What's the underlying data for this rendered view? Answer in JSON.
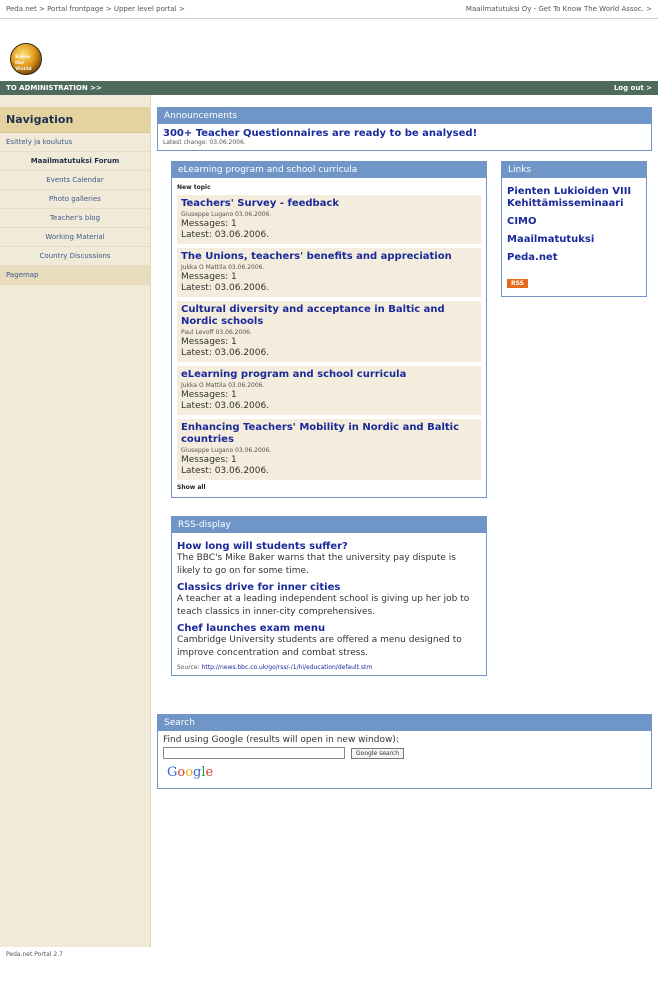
{
  "breadcrumbs": [
    "Peda.net >",
    "Portal frontpage >",
    "Upper level portal >"
  ],
  "org_title": "Maailmatutuksi Oy - Get To Know The World Assoc. >",
  "logo_text": "Know the World",
  "admin_link": "TO ADMINISTRATION >>",
  "logout": "Log out >",
  "navigation": {
    "title": "Navigation",
    "items": [
      {
        "label": "Esittely ja koulutus",
        "sub": false,
        "active": false
      },
      {
        "label": "Maailmatutuksi Forum",
        "sub": true,
        "active": true
      },
      {
        "label": "Events Calendar",
        "sub": true,
        "active": false
      },
      {
        "label": "Photo galleries",
        "sub": true,
        "active": false
      },
      {
        "label": "Teacher's blog",
        "sub": true,
        "active": false
      },
      {
        "label": "Working Material",
        "sub": true,
        "active": false
      },
      {
        "label": "Country Discussions",
        "sub": true,
        "active": false
      }
    ],
    "pagemap": "Pagemap"
  },
  "announcements": {
    "title": "Announcements",
    "headline": "300+ Teacher Questionnaires are ready to be analysed!",
    "latest": "Latest change: 03.06.2006."
  },
  "forum": {
    "title": "eLearning program and school curricula",
    "new_topic": "New topic",
    "posts": [
      {
        "title": "Teachers' Survey - feedback",
        "meta": "Giuseppe Lugano 03.06.2006.",
        "messages": "Messages: 1",
        "latest": "Latest: 03.06.2006."
      },
      {
        "title": "The Unions, teachers' benefits and appreciation",
        "meta": "Jukka O Mattila 03.06.2006.",
        "messages": "Messages: 1",
        "latest": "Latest: 03.06.2006."
      },
      {
        "title": "Cultural diversity and acceptance in Baltic and Nordic schools",
        "meta": "Paul Levoff 03.06.2006.",
        "messages": "Messages: 1",
        "latest": "Latest: 03.06.2006."
      },
      {
        "title": "eLearning program and school curricula",
        "meta": "Jukka O Mattila 03.06.2006.",
        "messages": "Messages: 1",
        "latest": "Latest: 03.06.2006."
      },
      {
        "title": "Enhancing Teachers' Mobility in Nordic and Baltic countries",
        "meta": "Giuseppe Lugano 03.06.2006.",
        "messages": "Messages: 1",
        "latest": "Latest: 03.06.2006."
      }
    ],
    "show_all": "Show all"
  },
  "links": {
    "title": "Links",
    "items": [
      "Pienten Lukioiden VIII Kehittämisseminaari",
      "CIMO",
      "Maailmatutuksi",
      "Peda.net"
    ],
    "rss": "RSS"
  },
  "rss": {
    "title": "RSS-display",
    "items": [
      {
        "title": "How long will students suffer?",
        "desc": "The BBC's Mike Baker warns that the university pay dispute is likely to go on for some time."
      },
      {
        "title": "Classics drive for inner cities",
        "desc": "A teacher at a leading independent school is giving up her job to teach classics in inner-city comprehensives."
      },
      {
        "title": "Chef launches exam menu",
        "desc": "Cambridge University students are offered a menu designed to improve concentration and combat stress."
      }
    ],
    "source_label": "Source:",
    "source_url": "http://news.bbc.co.uk/go/rss/-/1/hi/education/default.stm"
  },
  "search": {
    "title": "Search",
    "text": "Find using Google (results will open in new window):",
    "button": "Google search",
    "logo": [
      "G",
      "o",
      "o",
      "g",
      "l",
      "e"
    ]
  },
  "footer": "Peda.net Portal 2.7"
}
